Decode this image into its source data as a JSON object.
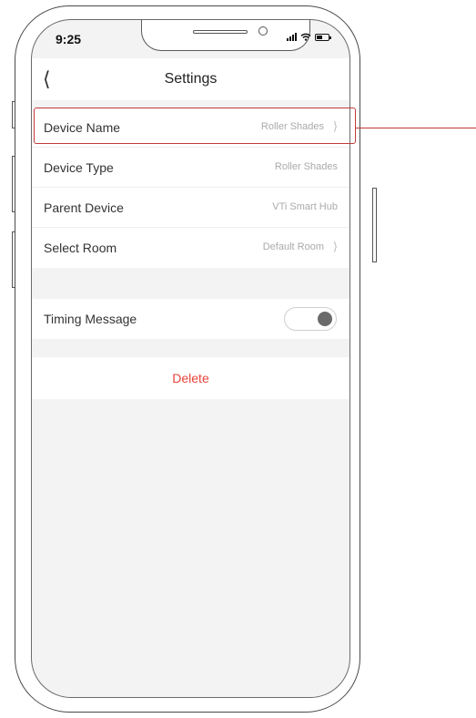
{
  "status_bar": {
    "time": "9:25"
  },
  "header": {
    "back_icon": "chevron-left-icon",
    "title": "Settings"
  },
  "settings": [
    {
      "label": "Device Name",
      "value": "Roller Shades",
      "chevron": true
    },
    {
      "label": "Device Type",
      "value": "Roller Shades",
      "chevron": false
    },
    {
      "label": "Parent Device",
      "value": "VTi Smart Hub",
      "chevron": false
    },
    {
      "label": "Select Room",
      "value": "Default Room",
      "chevron": true
    }
  ],
  "timing": {
    "label": "Timing Message",
    "enabled": false
  },
  "delete_label": "Delete",
  "colors": {
    "highlight": "#c23a3a",
    "delete": "#e8443a",
    "background": "#f3f3f3"
  }
}
